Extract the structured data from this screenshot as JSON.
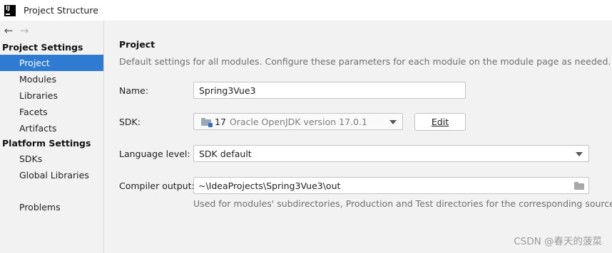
{
  "window": {
    "logo_text": "IJ",
    "title": "Project Structure"
  },
  "nav": {
    "back_icon": "←",
    "forward_icon": "→"
  },
  "sidebar": {
    "project_settings_header": "Project Settings",
    "project_settings_items": [
      {
        "label": "Project",
        "selected": true
      },
      {
        "label": "Modules",
        "selected": false
      },
      {
        "label": "Libraries",
        "selected": false
      },
      {
        "label": "Facets",
        "selected": false
      },
      {
        "label": "Artifacts",
        "selected": false
      }
    ],
    "platform_settings_header": "Platform Settings",
    "platform_settings_items": [
      {
        "label": "SDKs"
      },
      {
        "label": "Global Libraries"
      }
    ],
    "problems_label": "Problems"
  },
  "main": {
    "title": "Project",
    "description": "Default settings for all modules. Configure these parameters for each module on the module page as needed.",
    "name_label": "Name:",
    "name_value": "Spring3Vue3",
    "sdk_label": "SDK:",
    "sdk_version": "17",
    "sdk_value": "Oracle OpenJDK version 17.0.1",
    "edit_button_label": "Edit",
    "language_level_label": "Language level:",
    "language_level_value": "SDK default",
    "compiler_output_label": "Compiler output:",
    "compiler_output_value": "~\\IdeaProjects\\Spring3Vue3\\out",
    "compiler_output_hint": "Used for modules' subdirectories, Production and Test directories for the corresponding sources."
  },
  "watermark": "CSDN @春天的菠菜",
  "colors": {
    "selection": "#2f7bd1",
    "background": "#f2f2f2",
    "muted_text": "#707070"
  }
}
